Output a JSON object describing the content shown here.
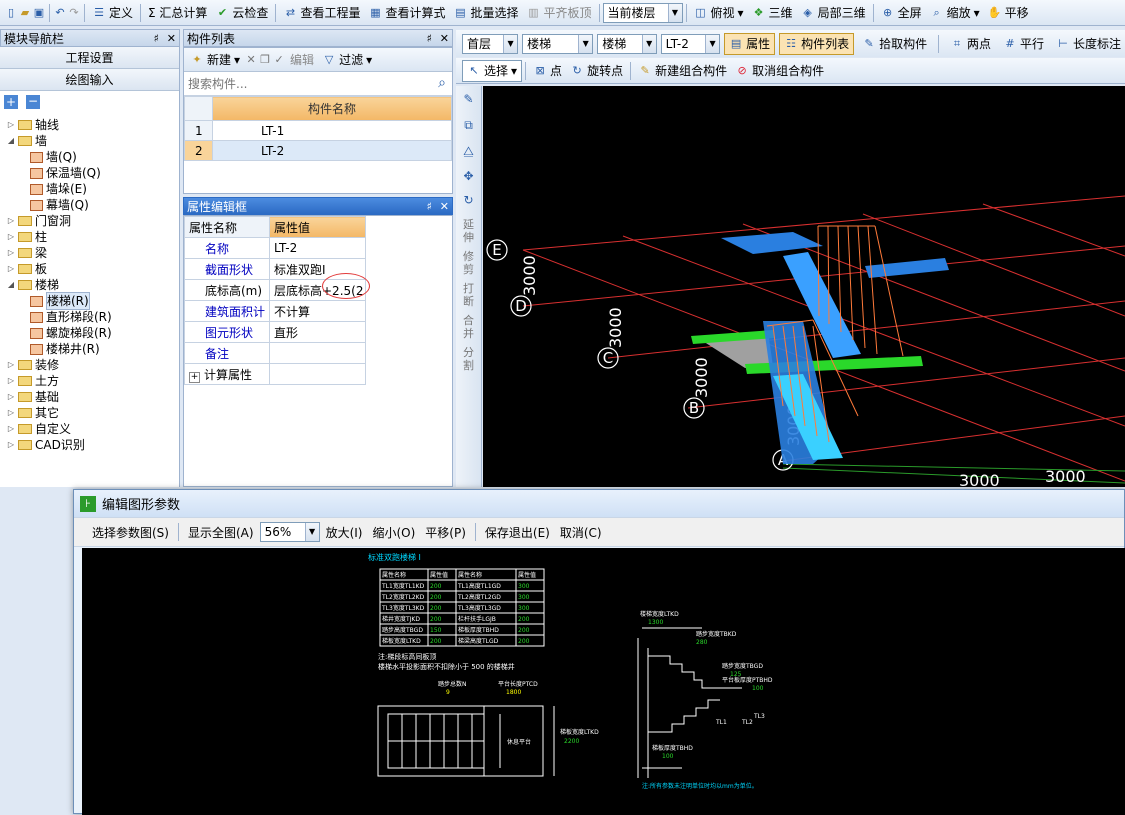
{
  "top_toolbar": {
    "items": [
      "定义",
      "Σ 汇总计算",
      "云检查",
      "查看工程量",
      "查看计算式",
      "批量选择",
      "平齐板顶"
    ],
    "floor_combo": "当前楼层",
    "view_items": [
      "俯视",
      "三维",
      "局部三维",
      "全屏",
      "缩放",
      "平移"
    ]
  },
  "nav_panel": {
    "title": "模块导航栏",
    "buttons": [
      "工程设置",
      "绘图输入"
    ],
    "tree": [
      {
        "label": "轴线",
        "level": 0,
        "exp": "▷"
      },
      {
        "label": "墙",
        "level": 0,
        "exp": "◢"
      },
      {
        "label": "墙(Q)",
        "level": 1
      },
      {
        "label": "保温墙(Q)",
        "level": 1
      },
      {
        "label": "墙垛(E)",
        "level": 1
      },
      {
        "label": "幕墙(Q)",
        "level": 1
      },
      {
        "label": "门窗洞",
        "level": 0,
        "exp": "▷"
      },
      {
        "label": "柱",
        "level": 0,
        "exp": "▷"
      },
      {
        "label": "梁",
        "level": 0,
        "exp": "▷"
      },
      {
        "label": "板",
        "level": 0,
        "exp": "▷"
      },
      {
        "label": "楼梯",
        "level": 0,
        "exp": "◢"
      },
      {
        "label": "楼梯(R)",
        "level": 1
      },
      {
        "label": "直形梯段(R)",
        "level": 1
      },
      {
        "label": "螺旋梯段(R)",
        "level": 1
      },
      {
        "label": "楼梯井(R)",
        "level": 1
      },
      {
        "label": "装修",
        "level": 0,
        "exp": "▷"
      },
      {
        "label": "土方",
        "level": 0,
        "exp": "▷"
      },
      {
        "label": "基础",
        "level": 0,
        "exp": "▷"
      },
      {
        "label": "其它",
        "level": 0,
        "exp": "▷"
      },
      {
        "label": "自定义",
        "level": 0,
        "exp": "▷"
      },
      {
        "label": "CAD识别",
        "level": 0,
        "exp": "▷"
      }
    ]
  },
  "component_list": {
    "title": "构件列表",
    "new_label": "新建",
    "edit_label": "编辑",
    "filter_label": "过滤",
    "search_placeholder": "搜索构件...",
    "column_header": "构件名称",
    "rows": [
      {
        "no": "1",
        "name": "LT-1"
      },
      {
        "no": "2",
        "name": "LT-2"
      }
    ]
  },
  "props_panel": {
    "title": "属性编辑框",
    "header_name": "属性名称",
    "header_value": "属性值",
    "rows": [
      {
        "name": "名称",
        "value": "LT-2",
        "blue": true
      },
      {
        "name": "截面形状",
        "value": "标准双跑I",
        "blue": true
      },
      {
        "name": "底标高(m)",
        "value": "层底标高+2.5(2",
        "blue": false
      },
      {
        "name": "建筑面积计",
        "value": "不计算",
        "blue": true
      },
      {
        "name": "图元形状",
        "value": "直形",
        "blue": true
      },
      {
        "name": "备注",
        "value": "",
        "blue": true
      },
      {
        "name": "计算属性",
        "value": "",
        "blue": false,
        "expand": "+"
      }
    ]
  },
  "canvas_toolbar": {
    "floor": "首层",
    "category": "楼梯",
    "type": "楼梯",
    "component": "LT-2",
    "attr_btn": "属性",
    "list_btn": "构件列表",
    "pick_btn": "拾取构件",
    "two_point": "两点",
    "parallel": "平行",
    "length_label": "长度标注"
  },
  "canvas_toolbar2": {
    "select": "选择",
    "point": "点",
    "rotate_point": "旋转点",
    "new_combo": "新建组合构件",
    "cancel_combo": "取消组合构件"
  },
  "side_tools": [
    "延伸",
    "修剪",
    "打断",
    "合并",
    "分割"
  ],
  "axis_labels": [
    "E",
    "D",
    "C",
    "B",
    "A"
  ],
  "dims": [
    "3000",
    "3000",
    "3000",
    "3000",
    "3000",
    "3000"
  ],
  "dialog": {
    "title": "编辑图形参数",
    "buttons": [
      "选择参数图(S)",
      "显示全图(A)",
      "放大(I)",
      "缩小(O)",
      "平移(P)",
      "保存退出(E)",
      "取消(C)"
    ],
    "zoom": "56%",
    "drawing": {
      "title": "标准双跑楼梯 I",
      "table_header": [
        "属性名称",
        "属性值",
        "属性名称",
        "属性值"
      ],
      "table_rows": [
        [
          "TL1宽度TL1KD",
          "200",
          "TL1高度TL1GD",
          "300"
        ],
        [
          "TL2宽度TL2KD",
          "200",
          "TL2高度TL2GD",
          "300"
        ],
        [
          "TL3宽度TL3KD",
          "200",
          "TL3高度TL3GD",
          "300"
        ],
        [
          "梯井宽度TJKD",
          "200",
          "栏杆扶手LGJB",
          "200"
        ],
        [
          "踏步高度TBGD",
          "150",
          "梯板厚度TBHD",
          "200"
        ],
        [
          "梯板宽度LTKD",
          "200",
          "梯梁高度TLGD",
          "200"
        ]
      ],
      "note1": "注:梯段标高同板顶",
      "note2": "楼梯水平投影面积不扣除小于 500 的楼梯井",
      "labels": [
        "踏步总数N",
        "平台长度PTCD",
        "9",
        "1800",
        "梯板宽度LTKD",
        "2200",
        "休息平台",
        "楼梯宽度LTKD",
        "1300",
        "踏步宽度TBKD",
        "280",
        "踏步宽度TBGD",
        "125",
        "平台板厚度PTBHD",
        "100",
        "梯板厚度TBHD",
        "100",
        "TL1",
        "TL2",
        "TL3"
      ],
      "footer": "注:所有参数未注明单位时均以mm为单位。"
    }
  }
}
